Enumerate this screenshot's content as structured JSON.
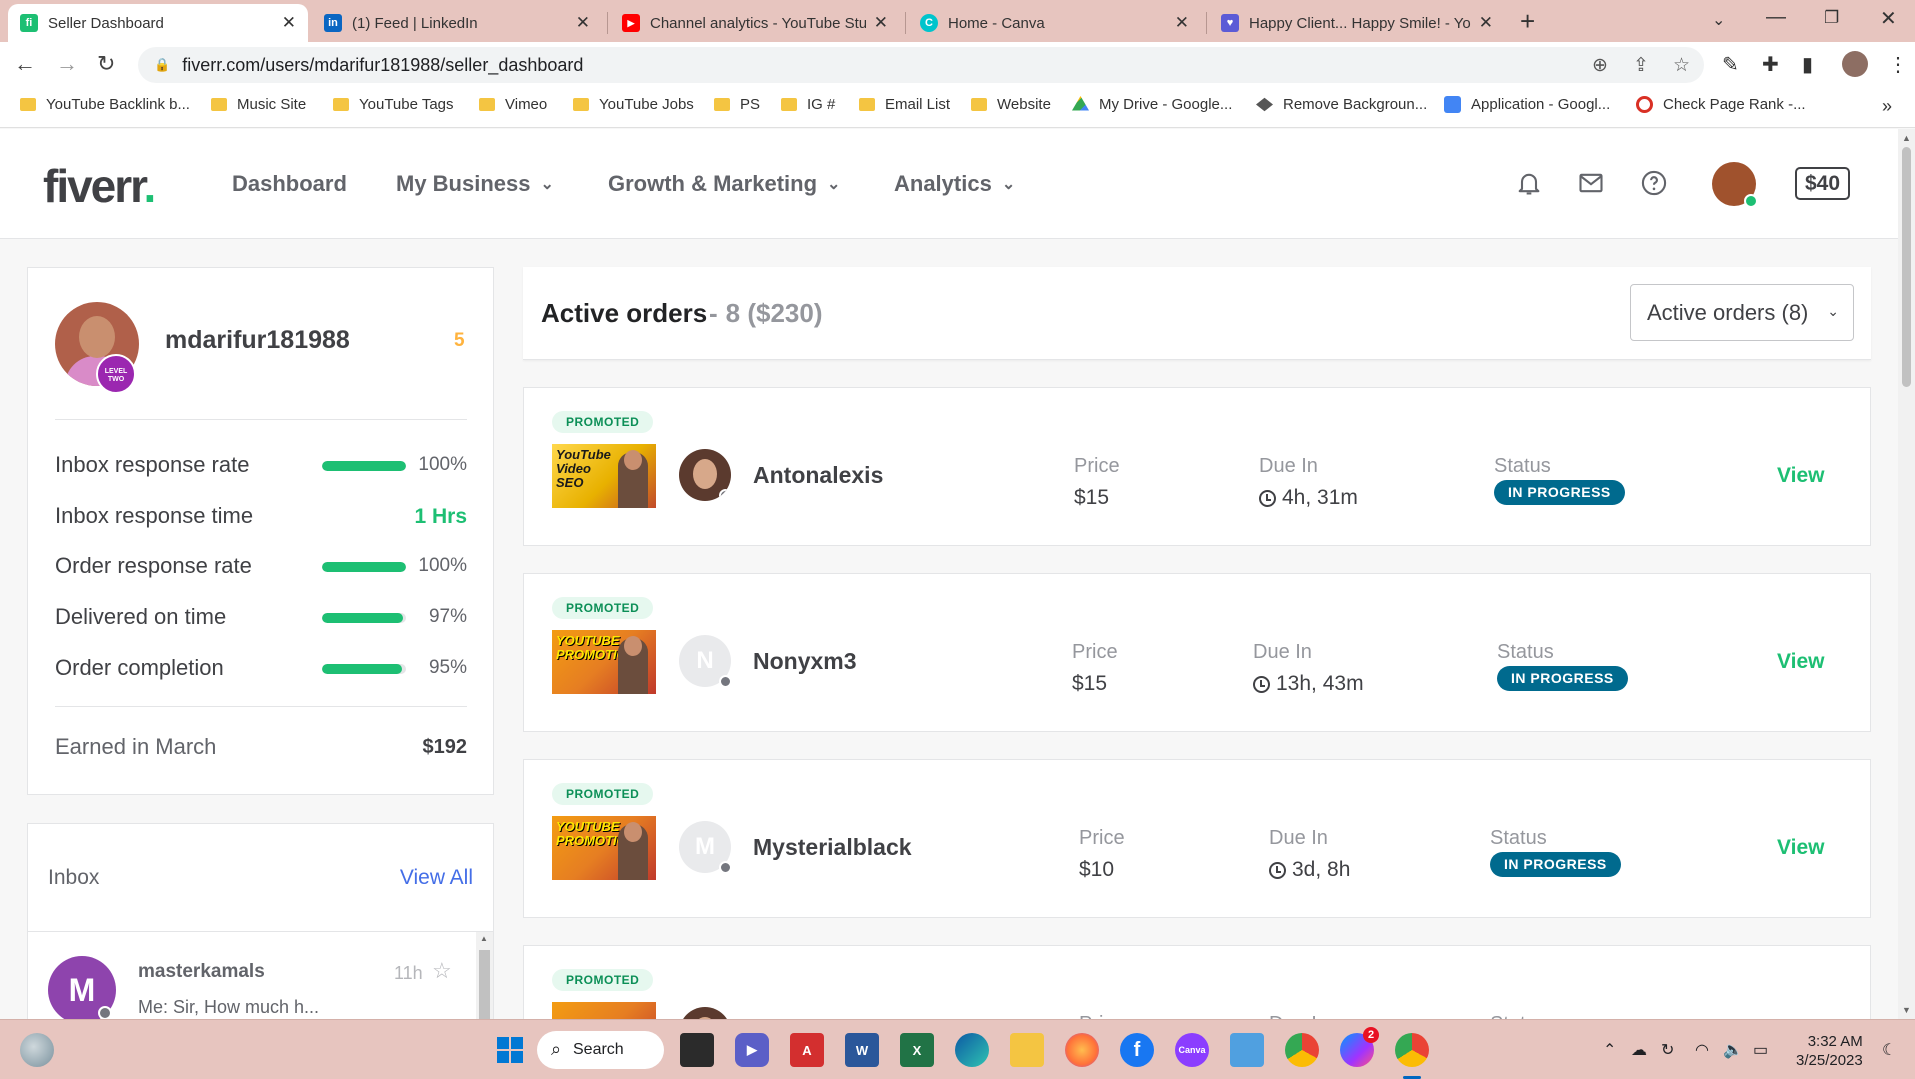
{
  "browser": {
    "tabs": [
      {
        "title": "Seller Dashboard",
        "icon": "fiverr-favicon",
        "color": "#1dbf73",
        "glyph": "fi"
      },
      {
        "title": "(1) Feed | LinkedIn",
        "icon": "linkedin-favicon",
        "color": "#0a66c2",
        "glyph": "in"
      },
      {
        "title": "Channel analytics - YouTube Studio",
        "icon": "youtube-favicon",
        "color": "#ff0000",
        "glyph": "▶"
      },
      {
        "title": "Home - Canva",
        "icon": "canva-favicon",
        "color": "#00c4cc",
        "glyph": "C"
      },
      {
        "title": "Happy Client... Happy Smile! - Yo",
        "icon": "heart-favicon",
        "color": "#5b5bd6",
        "glyph": "♥"
      }
    ],
    "url": "fiverr.com/users/mdarifur181988/seller_dashboard",
    "bookmarks": [
      {
        "label": "YouTube Backlink b...",
        "type": "folder"
      },
      {
        "label": "Music Site",
        "type": "folder"
      },
      {
        "label": "YouTube Tags",
        "type": "folder"
      },
      {
        "label": "Vimeo",
        "type": "folder"
      },
      {
        "label": "YouTube Jobs",
        "type": "folder"
      },
      {
        "label": "PS",
        "type": "folder"
      },
      {
        "label": "IG #",
        "type": "folder"
      },
      {
        "label": "Email List",
        "type": "folder"
      },
      {
        "label": "Website",
        "type": "folder"
      },
      {
        "label": "My Drive - Google...",
        "type": "drive"
      },
      {
        "label": "Remove Backgroun...",
        "type": "site"
      },
      {
        "label": "Application - Googl...",
        "type": "doc"
      },
      {
        "label": "Check Page Rank -...",
        "type": "site2"
      }
    ]
  },
  "nav": {
    "logo": "fiverr",
    "logo_dot": ".",
    "links": [
      "Dashboard",
      "My Business",
      "Growth & Marketing",
      "Analytics"
    ],
    "balance": "$40"
  },
  "profile": {
    "username": "mdarifur181988",
    "count": "5",
    "level_badge": "LEVEL TWO",
    "stats": [
      {
        "label": "Inbox response rate",
        "value": "100%",
        "fill": 1.0
      },
      {
        "label": "Inbox response time",
        "value": "1 Hrs"
      },
      {
        "label": "Order response rate",
        "value": "100%",
        "fill": 1.0
      },
      {
        "label": "Delivered on time",
        "value": "97%",
        "fill": 0.97
      },
      {
        "label": "Order completion",
        "value": "95%",
        "fill": 0.95
      }
    ],
    "earned_label": "Earned in March",
    "earned_value": "$192"
  },
  "inbox": {
    "title": "Inbox",
    "view_all": "View All",
    "messages": [
      {
        "initial": "M",
        "name": "masterkamals",
        "time": "11h",
        "text": "Me: Sir, How much h..."
      }
    ]
  },
  "orders": {
    "title": "Active orders",
    "summary_dash": "-",
    "summary": "8 ($230)",
    "dropdown": "Active orders (8)",
    "price_label": "Price",
    "due_label": "Due In",
    "status_label": "Status",
    "promoted_label": "PROMOTED",
    "view_label": "View",
    "items": [
      {
        "buyer": "Antonalexis",
        "initial": "",
        "price": "$15",
        "due": "4h, 31m",
        "status": "IN PROGRESS",
        "thumb_text": "YouTube Video SEO"
      },
      {
        "buyer": "Nonyxm3",
        "initial": "N",
        "price": "$15",
        "due": "13h, 43m",
        "status": "IN PROGRESS",
        "thumb_text": "YOUTUBE PROMOTION"
      },
      {
        "buyer": "Mysterialblack",
        "initial": "M",
        "price": "$10",
        "due": "3d, 8h",
        "status": "IN PROGRESS",
        "thumb_text": "YOUTUBE PROMOTION"
      },
      {
        "buyer": "",
        "initial": "",
        "price": "",
        "due": "",
        "status": "",
        "thumb_text": ""
      }
    ]
  },
  "taskbar": {
    "search": "Search",
    "time": "3:32 AM",
    "date": "3/25/2023",
    "messenger_badge": "2"
  }
}
